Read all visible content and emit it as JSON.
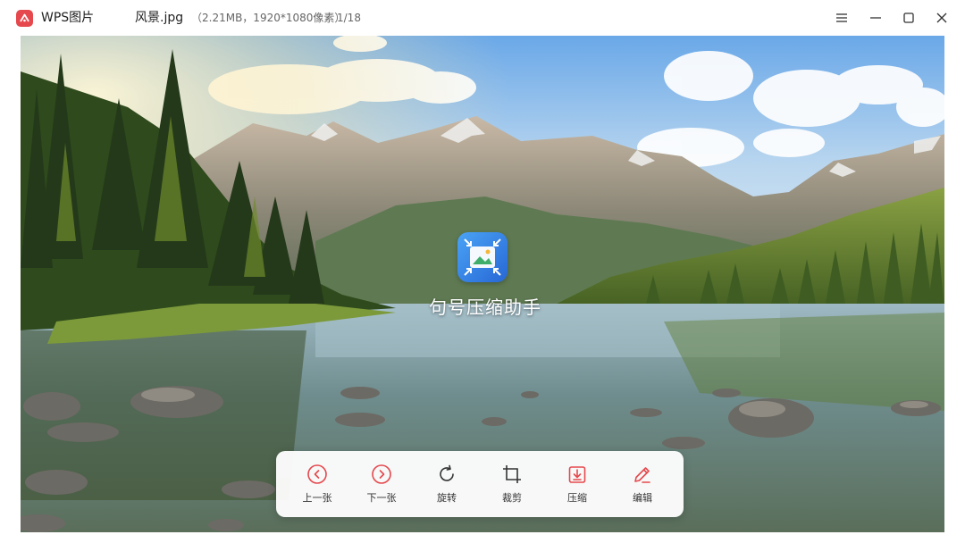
{
  "titlebar": {
    "app_name": "WPS图片",
    "file_name": "风景.jpg",
    "file_info": "（2.21MB，1920*1080像素）",
    "file_index": "1/18",
    "buttons": [
      "menu-icon",
      "minimize-icon",
      "maximize-icon",
      "close-icon"
    ]
  },
  "watermark": {
    "icon": "image-compress-icon",
    "text": "句号压缩助手"
  },
  "toolbar": {
    "items": [
      {
        "label": "上一张",
        "icon": "chevron-left-circle-icon"
      },
      {
        "label": "下一张",
        "icon": "chevron-right-circle-icon"
      },
      {
        "label": "旋转",
        "icon": "rotate-icon"
      },
      {
        "label": "裁剪",
        "icon": "crop-icon"
      },
      {
        "label": "压缩",
        "icon": "compress-icon"
      },
      {
        "label": "编辑",
        "icon": "pencil-icon"
      }
    ]
  },
  "colors": {
    "accent": "#e5484d",
    "brand_logo": "#e5484d",
    "watermark_icon": "#2f7be5"
  }
}
